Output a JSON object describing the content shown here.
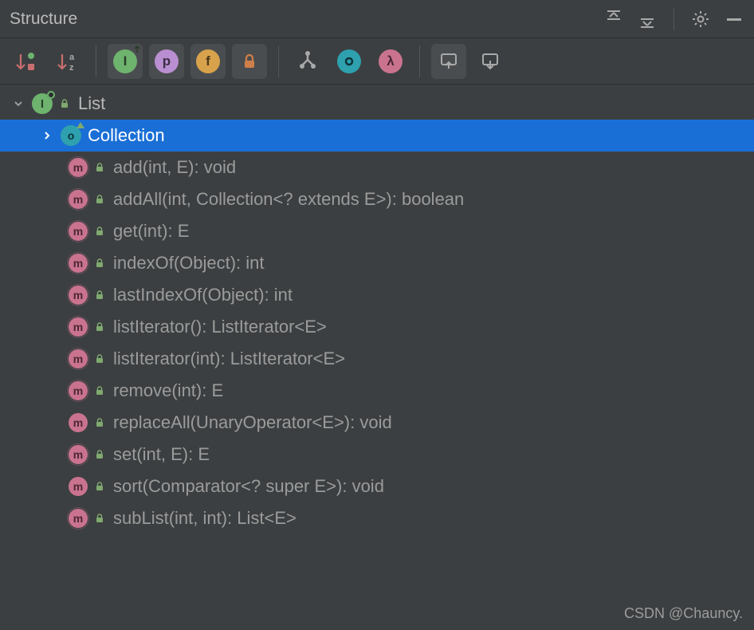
{
  "panel": {
    "title": "Structure"
  },
  "header_icons": {
    "expand_all": "expand-all",
    "collapse_all": "collapse-all",
    "settings": "settings",
    "hide": "hide"
  },
  "toolbar": {
    "sort_visibility": "sort-by-visibility",
    "sort_alpha": "sort-alphabetically",
    "interface_filter": "I",
    "property_filter": "p",
    "field_filter": "f",
    "nonpublic_filter": "non-public",
    "inherited": "show-inherited",
    "anonymous": "show-anonymous",
    "lambda": "λ",
    "autoscroll_to": "autoscroll-to-source",
    "autoscroll_from": "autoscroll-from-source"
  },
  "tree": {
    "root": {
      "label": "List",
      "icon_letter": "I"
    },
    "selected": {
      "label": "Collection",
      "icon_letter": "o"
    },
    "methods": [
      {
        "label": "add(int, E): void",
        "abstract": true
      },
      {
        "label": "addAll(int, Collection<? extends E>): boolean",
        "abstract": true
      },
      {
        "label": "get(int): E",
        "abstract": true
      },
      {
        "label": "indexOf(Object): int",
        "abstract": true
      },
      {
        "label": "lastIndexOf(Object): int",
        "abstract": true
      },
      {
        "label": "listIterator(): ListIterator<E>",
        "abstract": true
      },
      {
        "label": "listIterator(int): ListIterator<E>",
        "abstract": true
      },
      {
        "label": "remove(int): E",
        "abstract": true
      },
      {
        "label": "replaceAll(UnaryOperator<E>): void",
        "abstract": false
      },
      {
        "label": "set(int, E): E",
        "abstract": true
      },
      {
        "label": "sort(Comparator<? super E>): void",
        "abstract": false
      },
      {
        "label": "subList(int, int): List<E>",
        "abstract": true
      }
    ]
  },
  "watermark": "CSDN @Chauncy."
}
